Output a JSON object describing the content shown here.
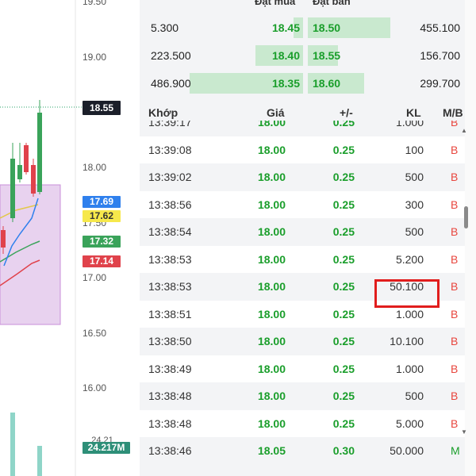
{
  "chart": {
    "price_axis": [
      "19.50",
      "19.00",
      "18.00",
      "17.50",
      "17.00",
      "16.50",
      "16.00"
    ],
    "last_price_tag": "18.55",
    "tags": [
      {
        "label": "17.69",
        "color": "#2f80ed",
        "text": "#ffffff"
      },
      {
        "label": "17.62",
        "color": "#f6e84b",
        "text": "#333333"
      },
      {
        "label": "17.32",
        "color": "#3aa35a",
        "text": "#ffffff"
      },
      {
        "label": "17.14",
        "color": "#e0424b",
        "text": "#ffffff"
      }
    ],
    "volume_tag": "24.217M",
    "volume_cut_label": "24.21"
  },
  "order_book": {
    "headers": {
      "bid": "Đặt mua",
      "ask": "Đặt bán"
    },
    "rows": [
      {
        "bid_vol": "5.300",
        "bid_price": "18.45",
        "ask_price": "18.50",
        "ask_vol": "455.100",
        "bid_level": 0.08,
        "ask_level": 0.9
      },
      {
        "bid_vol": "223.500",
        "bid_price": "18.40",
        "ask_price": "18.55",
        "ask_vol": "156.700",
        "bid_level": 0.4,
        "ask_level": 0.33
      },
      {
        "bid_vol": "486.900",
        "bid_price": "18.35",
        "ask_price": "18.60",
        "ask_vol": "299.700",
        "bid_level": 0.95,
        "ask_level": 0.62
      }
    ]
  },
  "trades": {
    "columns": {
      "time": "Khớp",
      "price": "Giá",
      "change": "+/-",
      "volume": "KL",
      "side": "M/B"
    },
    "rows": [
      {
        "time": "13:39:17",
        "price": "18.00",
        "change": "0.25",
        "volume": "1.000",
        "side": "B"
      },
      {
        "time": "13:39:08",
        "price": "18.00",
        "change": "0.25",
        "volume": "100",
        "side": "B"
      },
      {
        "time": "13:39:02",
        "price": "18.00",
        "change": "0.25",
        "volume": "500",
        "side": "B"
      },
      {
        "time": "13:38:56",
        "price": "18.00",
        "change": "0.25",
        "volume": "300",
        "side": "B"
      },
      {
        "time": "13:38:54",
        "price": "18.00",
        "change": "0.25",
        "volume": "500",
        "side": "B"
      },
      {
        "time": "13:38:53",
        "price": "18.00",
        "change": "0.25",
        "volume": "5.200",
        "side": "B"
      },
      {
        "time": "13:38:53",
        "price": "18.00",
        "change": "0.25",
        "volume": "50.100",
        "side": "B"
      },
      {
        "time": "13:38:51",
        "price": "18.00",
        "change": "0.25",
        "volume": "1.000",
        "side": "B"
      },
      {
        "time": "13:38:50",
        "price": "18.00",
        "change": "0.25",
        "volume": "10.100",
        "side": "B"
      },
      {
        "time": "13:38:49",
        "price": "18.00",
        "change": "0.25",
        "volume": "1.000",
        "side": "B"
      },
      {
        "time": "13:38:48",
        "price": "18.00",
        "change": "0.25",
        "volume": "500",
        "side": "B"
      },
      {
        "time": "13:38:48",
        "price": "18.00",
        "change": "0.25",
        "volume": "5.000",
        "side": "B"
      },
      {
        "time": "13:38:46",
        "price": "18.05",
        "change": "0.30",
        "volume": "50.000",
        "side": "M"
      }
    ],
    "highlighted_row_index": 6
  },
  "colors": {
    "up": "#1a9e2b",
    "down": "#e8463e",
    "sell_side": "#e8463e",
    "buy_side": "#1a9e2b",
    "highlight": "#e11d1d"
  }
}
